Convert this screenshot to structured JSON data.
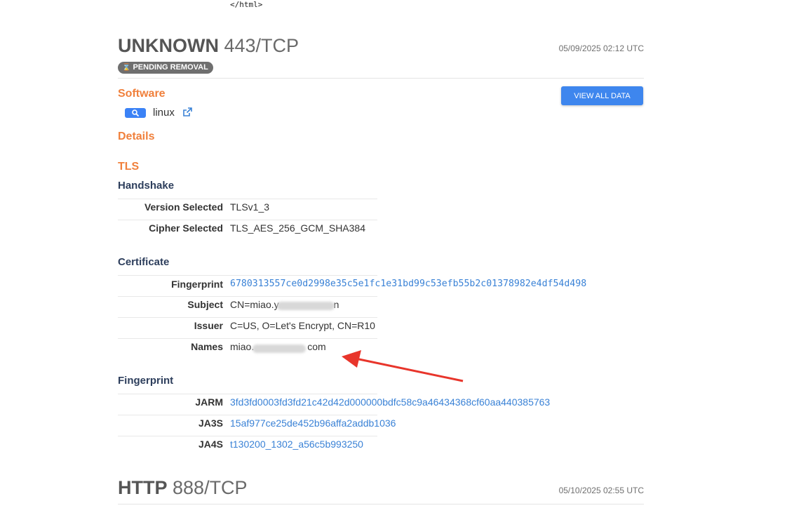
{
  "top": {
    "code_tail": "</html>"
  },
  "services": [
    {
      "name": "UNKNOWN",
      "port": "443/TCP",
      "date": "05/09/2025 02:12 UTC",
      "badge": "PENDING REMOVAL",
      "software": {
        "heading": "Software",
        "name": "linux"
      },
      "view_all_label": "VIEW ALL DATA",
      "details_heading": "Details",
      "tls": {
        "heading": "TLS",
        "handshake": {
          "heading": "Handshake",
          "rows": [
            {
              "key": "Version Selected",
              "value": "TLSv1_3"
            },
            {
              "key": "Cipher Selected",
              "value": "TLS_AES_256_GCM_SHA384"
            }
          ]
        },
        "certificate": {
          "heading": "Certificate",
          "rows": [
            {
              "key": "Fingerprint",
              "value": "6780313557ce0d2998e35c5e1fc1e31bd99c53efb55b2c01378982e4df54d498"
            },
            {
              "key": "Subject",
              "value": "CN=miao.y"
            },
            {
              "key": "Issuer",
              "value": "C=US, O=Let's Encrypt, CN=R10"
            },
            {
              "key": "Names",
              "value": "miao."
            }
          ]
        },
        "fingerprint": {
          "heading": "Fingerprint",
          "rows": [
            {
              "key": "JARM",
              "value": "3fd3fd0003fd3fd21c42d42d000000bdfc58c9a46434368cf60aa440385763"
            },
            {
              "key": "JA3S",
              "value": "15af977ce25de452b96affa2addb1036"
            },
            {
              "key": "JA4S",
              "value": "t130200_1302_a56c5b993250"
            }
          ]
        }
      }
    },
    {
      "name": "HTTP",
      "port": "888/TCP",
      "date": "05/10/2025 02:55 UTC"
    }
  ],
  "subject_tail": "n",
  "names_tail": "com",
  "colors": {
    "accent": "#f0803c",
    "link": "#3a82d6",
    "button": "#3e86ee",
    "arrow": "#e8352b"
  },
  "icons": [
    "hourglass-icon",
    "search-icon",
    "external-link-icon",
    "annotation-arrow"
  ]
}
